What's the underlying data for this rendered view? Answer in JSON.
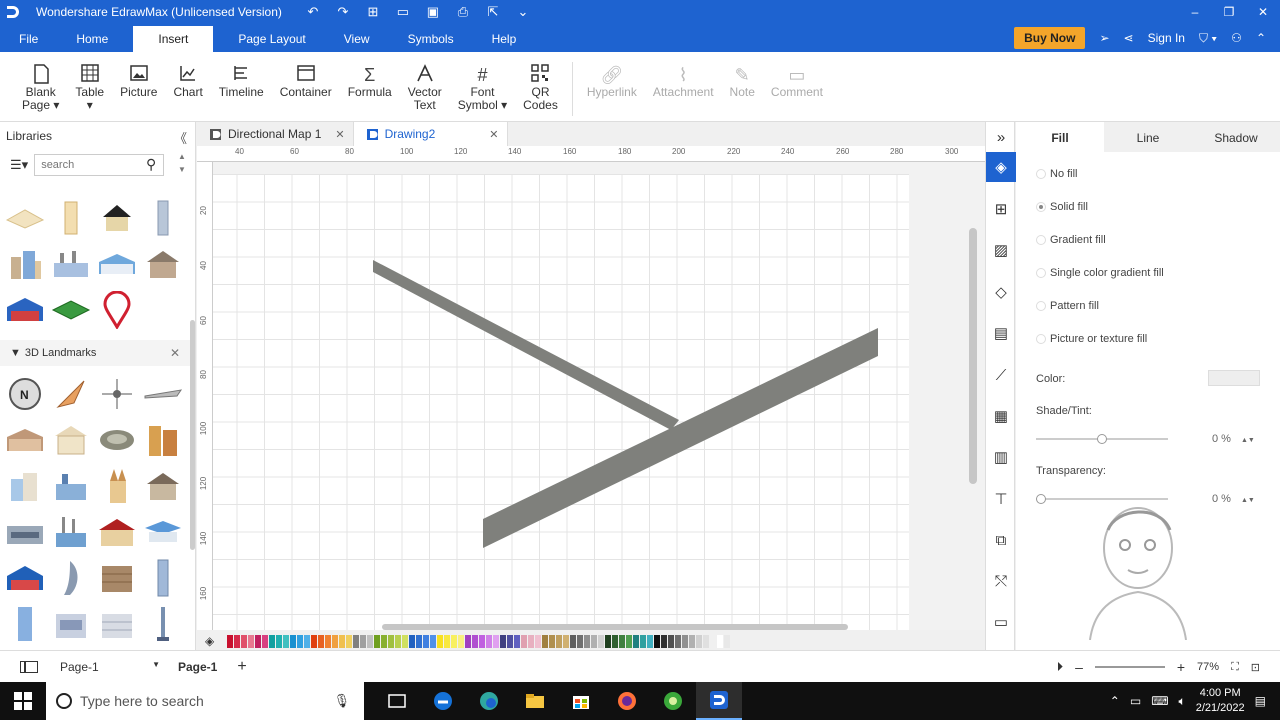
{
  "app": {
    "title": "Wondershare EdrawMax (Unlicensed Version)"
  },
  "menu": {
    "items": [
      "File",
      "Home",
      "Insert",
      "Page Layout",
      "View",
      "Symbols",
      "Help"
    ],
    "active": "Insert"
  },
  "header_right": {
    "buy_now": "Buy Now",
    "sign_in": "Sign In"
  },
  "ribbon": {
    "items": [
      {
        "label": "Blank\nPage ▾",
        "icon": "blank-page-icon"
      },
      {
        "label": "Table\n▾",
        "icon": "table-icon"
      },
      {
        "label": "Picture",
        "icon": "picture-icon"
      },
      {
        "label": "Chart",
        "icon": "chart-icon"
      },
      {
        "label": "Timeline",
        "icon": "timeline-icon"
      },
      {
        "label": "Container",
        "icon": "container-icon"
      },
      {
        "label": "Formula",
        "icon": "formula-icon"
      },
      {
        "label": "Vector\nText",
        "icon": "vector-text-icon"
      },
      {
        "label": "Font\nSymbol ▾",
        "icon": "font-symbol-icon"
      },
      {
        "label": "QR\nCodes",
        "icon": "qr-codes-icon"
      }
    ],
    "disabled_items": [
      {
        "label": "Hyperlink",
        "icon": "hyperlink-icon"
      },
      {
        "label": "Attachment",
        "icon": "attachment-icon"
      },
      {
        "label": "Note",
        "icon": "note-icon"
      },
      {
        "label": "Comment",
        "icon": "comment-icon"
      }
    ]
  },
  "libraries": {
    "title": "Libraries",
    "search_placeholder": "search",
    "section": "3D Landmarks"
  },
  "doc_tabs": [
    {
      "label": "Directional Map 1",
      "active": false
    },
    {
      "label": "Drawing2",
      "active": true
    }
  ],
  "ruler": {
    "h_ticks": [
      "40",
      "60",
      "80",
      "100",
      "120",
      "140",
      "160",
      "180",
      "200",
      "220",
      "240",
      "260",
      "280",
      "300"
    ],
    "v_ticks": [
      "20",
      "40",
      "60",
      "80",
      "100",
      "120",
      "140",
      "160"
    ]
  },
  "road_color": "#7f807c",
  "properties": {
    "tabs": [
      "Fill",
      "Line",
      "Shadow"
    ],
    "active_tab": "Fill",
    "fill_options": [
      "No fill",
      "Solid fill",
      "Gradient fill",
      "Single color gradient fill",
      "Pattern fill",
      "Picture or texture fill"
    ],
    "selected_fill": "Solid fill",
    "color_label": "Color:",
    "shade_label": "Shade/Tint:",
    "shade_value": "0 %",
    "transparency_label": "Transparency:",
    "transparency_value": "0 %"
  },
  "status": {
    "page_selector": "Page-1",
    "page_tab": "Page-1",
    "zoom": "77%"
  },
  "taskbar": {
    "search_placeholder": "Type here to search",
    "time": "4:00 PM",
    "date": "2/21/2022"
  }
}
